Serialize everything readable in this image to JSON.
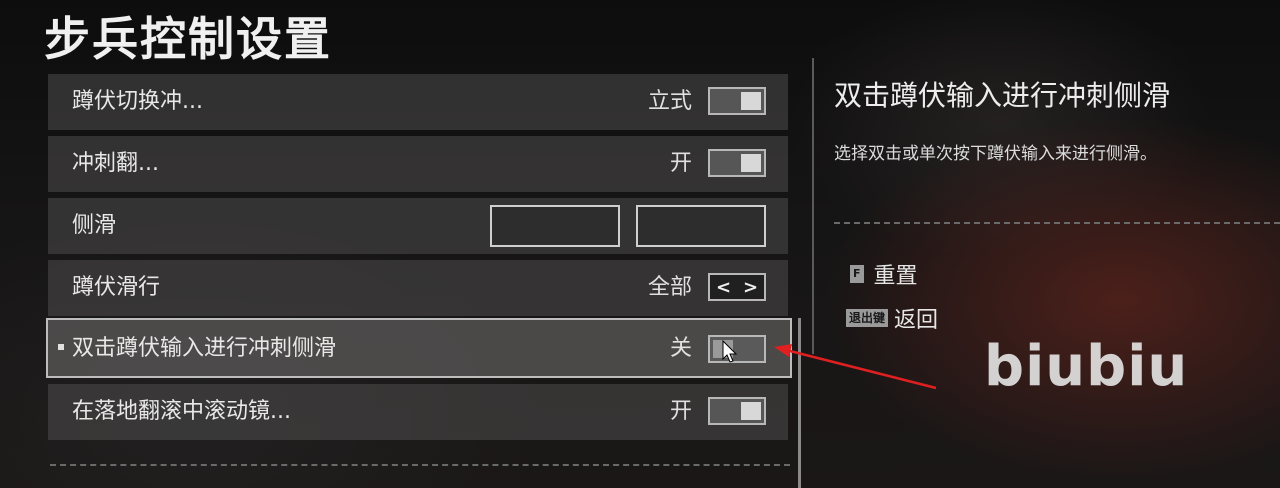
{
  "page": {
    "title": "步兵控制设置"
  },
  "settings": [
    {
      "label": "蹲伏切换冲...",
      "value": "立式",
      "control": "toggle",
      "state": "on"
    },
    {
      "label": "冲刺翻...",
      "value": "开",
      "control": "toggle",
      "state": "on"
    },
    {
      "label": "侧滑",
      "value": "",
      "control": "keybind"
    },
    {
      "label": "蹲伏滑行",
      "value": "全部",
      "control": "selector",
      "left_glyph": "<",
      "right_glyph": ">"
    },
    {
      "label": "双击蹲伏输入进行冲刺侧滑",
      "value": "关",
      "control": "toggle",
      "state": "off",
      "selected": true
    },
    {
      "label": "在落地翻滚中滚动镜...",
      "value": "开",
      "control": "toggle",
      "state": "on"
    }
  ],
  "detail_panel": {
    "title": "双击蹲伏输入进行冲刺侧滑",
    "description": "选择双击或单次按下蹲伏输入来进行侧滑。"
  },
  "hints": [
    {
      "key": "F",
      "label": "重置",
      "icon": "f-key-icon"
    },
    {
      "key": "退出键",
      "label": "返回",
      "icon": "esc-key-icon"
    }
  ],
  "watermark": "biubiu",
  "colors": {
    "annotation_arrow": "#e02020",
    "row_bg": "#4e4c4c",
    "selected_border": "#bdbdbd"
  }
}
